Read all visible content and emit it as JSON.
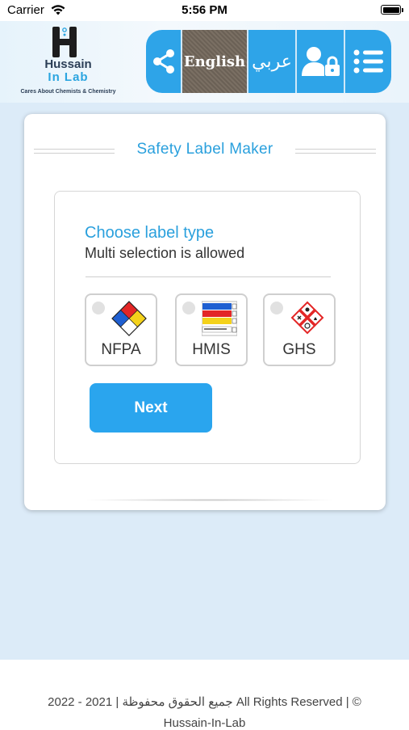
{
  "status_bar": {
    "carrier": "Carrier",
    "time": "5:56 PM"
  },
  "logo": {
    "name_line1": "Hussain",
    "name_line2": "In Lab",
    "tagline": "Cares About Chemists & Chemistry"
  },
  "toolbar": {
    "english_label": "English",
    "arabic_label": "عربي"
  },
  "card": {
    "title": "Safety Label Maker",
    "choose_title": "Choose label type",
    "choose_subtitle": "Multi selection is allowed",
    "options": [
      {
        "label": "NFPA",
        "icon": "nfpa-diamond-icon"
      },
      {
        "label": "HMIS",
        "icon": "hmis-label-icon"
      },
      {
        "label": "GHS",
        "icon": "ghs-pictograms-icon"
      }
    ],
    "next_label": "Next"
  },
  "footer": {
    "line1": "2022 - 2021 | جميع الحقوق محفوظة All Rights Reserved | ©",
    "line2": "Hussain-In-Lab"
  },
  "colors": {
    "accent": "#2ea4e8",
    "background": "#dcebf8",
    "title": "#2aa0dd"
  }
}
